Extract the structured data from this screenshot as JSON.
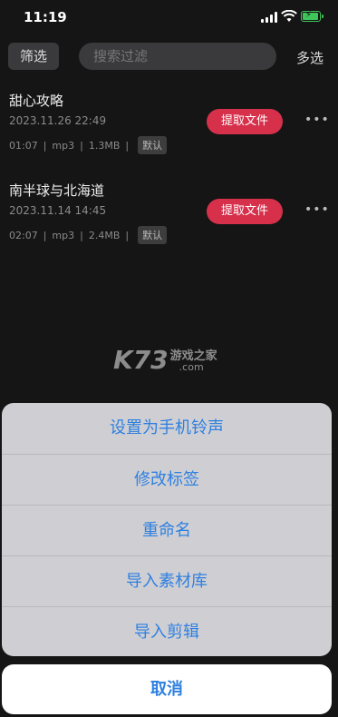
{
  "status_bar": {
    "time": "11:19",
    "signal_icon": "signal-icon",
    "wifi_icon": "wifi-icon",
    "battery_icon": "battery-charging-icon",
    "battery_color": "#3ec65a"
  },
  "toolbar": {
    "filter_label": "筛选",
    "search_placeholder": "搜索过滤",
    "multi_select_label": "多选"
  },
  "files": [
    {
      "name": "甜心攻略",
      "date": "2023.11.26 22:49",
      "duration": "01:07",
      "format": "mp3",
      "size": "1.3MB",
      "badge": "默认",
      "action_label": "提取文件",
      "more_icon": "more-horizontal-icon"
    },
    {
      "name": "南半球与北海道",
      "date": "2023.11.14 14:45",
      "duration": "02:07",
      "format": "mp3",
      "size": "2.4MB",
      "badge": "默认",
      "action_label": "提取文件",
      "more_icon": "more-horizontal-icon"
    }
  ],
  "watermark": {
    "logo": "K73",
    "text": "游戏之家",
    "domain": ".com"
  },
  "action_sheet": {
    "items": [
      "设置为手机铃声",
      "修改标签",
      "重命名",
      "导入素材库",
      "导入剪辑"
    ],
    "cancel_label": "取消"
  },
  "colors": {
    "accent": "#2e7fe0",
    "extract_button": "#d6304b",
    "background": "#151515"
  }
}
